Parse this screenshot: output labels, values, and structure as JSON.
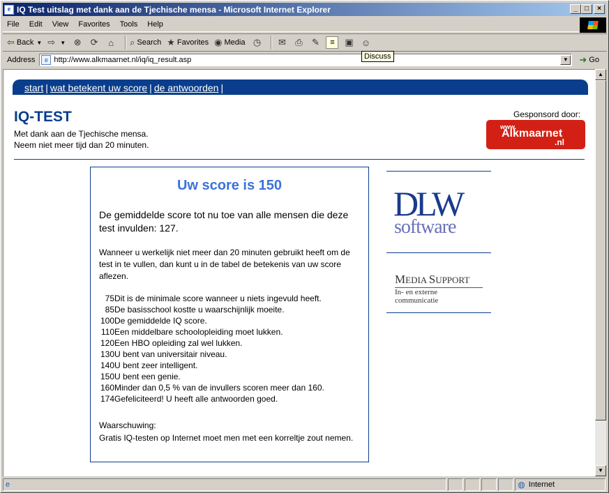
{
  "window": {
    "title": "IQ Test uitslag met dank aan de Tjechische mensa - Microsoft Internet Explorer",
    "minimize": "_",
    "maximize": "□",
    "close": "×"
  },
  "menu": [
    "File",
    "Edit",
    "View",
    "Favorites",
    "Tools",
    "Help"
  ],
  "toolbar": {
    "back": "Back",
    "search": "Search",
    "favorites": "Favorites",
    "media": "Media",
    "discuss_tooltip": "Discuss"
  },
  "address": {
    "label": "Address",
    "url": "http://www.alkmaarnet.nl/iq/iq_result.asp",
    "go": "Go"
  },
  "nav": {
    "start": "start",
    "meaning": "wat betekent uw score",
    "answers": "de antwoorden",
    "sep": "|"
  },
  "page": {
    "title": "IQ-TEST",
    "intro1": "Met dank aan de Tjechische mensa.",
    "intro2": "Neem niet meer tijd dan 20 minuten.",
    "sponsor_label": "Gesponsord door:",
    "sponsor_www": "www.",
    "sponsor_name": "Alkmaarnet",
    "sponsor_tld": ".nl"
  },
  "result": {
    "score_title": "Uw score is 150",
    "average": "De gemiddelde score tot nu toe van alle mensen die deze test invulden: 127.",
    "instructions": "Wanneer u werkelijk niet meer dan 20 minuten gebruikt heeft om de test in te vullen, dan kunt u in de tabel de betekenis van uw score aflezen.",
    "table": [
      {
        "score": "75",
        "desc": "Dit is de minimale score wanneer u niets ingevuld heeft."
      },
      {
        "score": "85",
        "desc": "De basisschool kostte u waarschijnlijk moeite."
      },
      {
        "score": "100",
        "desc": "De gemiddelde IQ score."
      },
      {
        "score": "110",
        "desc": "Een middelbare schoolopleiding moet lukken."
      },
      {
        "score": "120",
        "desc": "Een HBO opleiding zal wel lukken."
      },
      {
        "score": "130",
        "desc": "U bent van universitair niveau."
      },
      {
        "score": "140",
        "desc": "U bent zeer intelligent."
      },
      {
        "score": "150",
        "desc": "U bent een genie."
      },
      {
        "score": "160",
        "desc": "Minder dan 0,5 % van de invullers scoren meer dan 160."
      },
      {
        "score": "174",
        "desc": "Gefeliciteerd! U heeft alle antwoorden goed."
      }
    ],
    "warning_label": "Waarschuwing:",
    "warning_text": "Gratis IQ-testen op Internet moet men met een korreltje zout nemen."
  },
  "sidebar": {
    "dlw_top": "DLW",
    "dlw_bottom": "software",
    "ms_top_big": "M",
    "ms_top_small": "EDIA ",
    "ms_top_big2": "S",
    "ms_top_small2": "UPPORT",
    "ms_bottom": "In- en externe communicatie"
  },
  "status": {
    "zone": "Internet"
  }
}
